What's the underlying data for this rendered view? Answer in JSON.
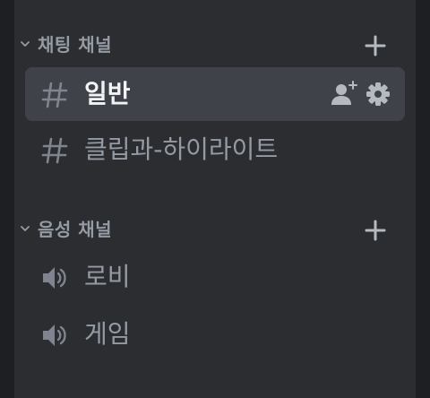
{
  "categories": [
    {
      "label": "채팅 채널",
      "channels": [
        {
          "label": "일반",
          "icon": "hash-icon",
          "selected": true
        },
        {
          "label": "클립과-하이라이트",
          "icon": "hash-icon",
          "selected": false
        }
      ]
    },
    {
      "label": "음성 채널",
      "channels": [
        {
          "label": "로비",
          "icon": "speaker-icon",
          "selected": false
        },
        {
          "label": "게임",
          "icon": "speaker-icon",
          "selected": false
        }
      ]
    }
  ],
  "colors": {
    "background": "#2b2d31",
    "rail": "#1e1f22",
    "selected_row": "#404249",
    "muted_text": "#949ba4",
    "active_text": "#f2f3f5"
  }
}
